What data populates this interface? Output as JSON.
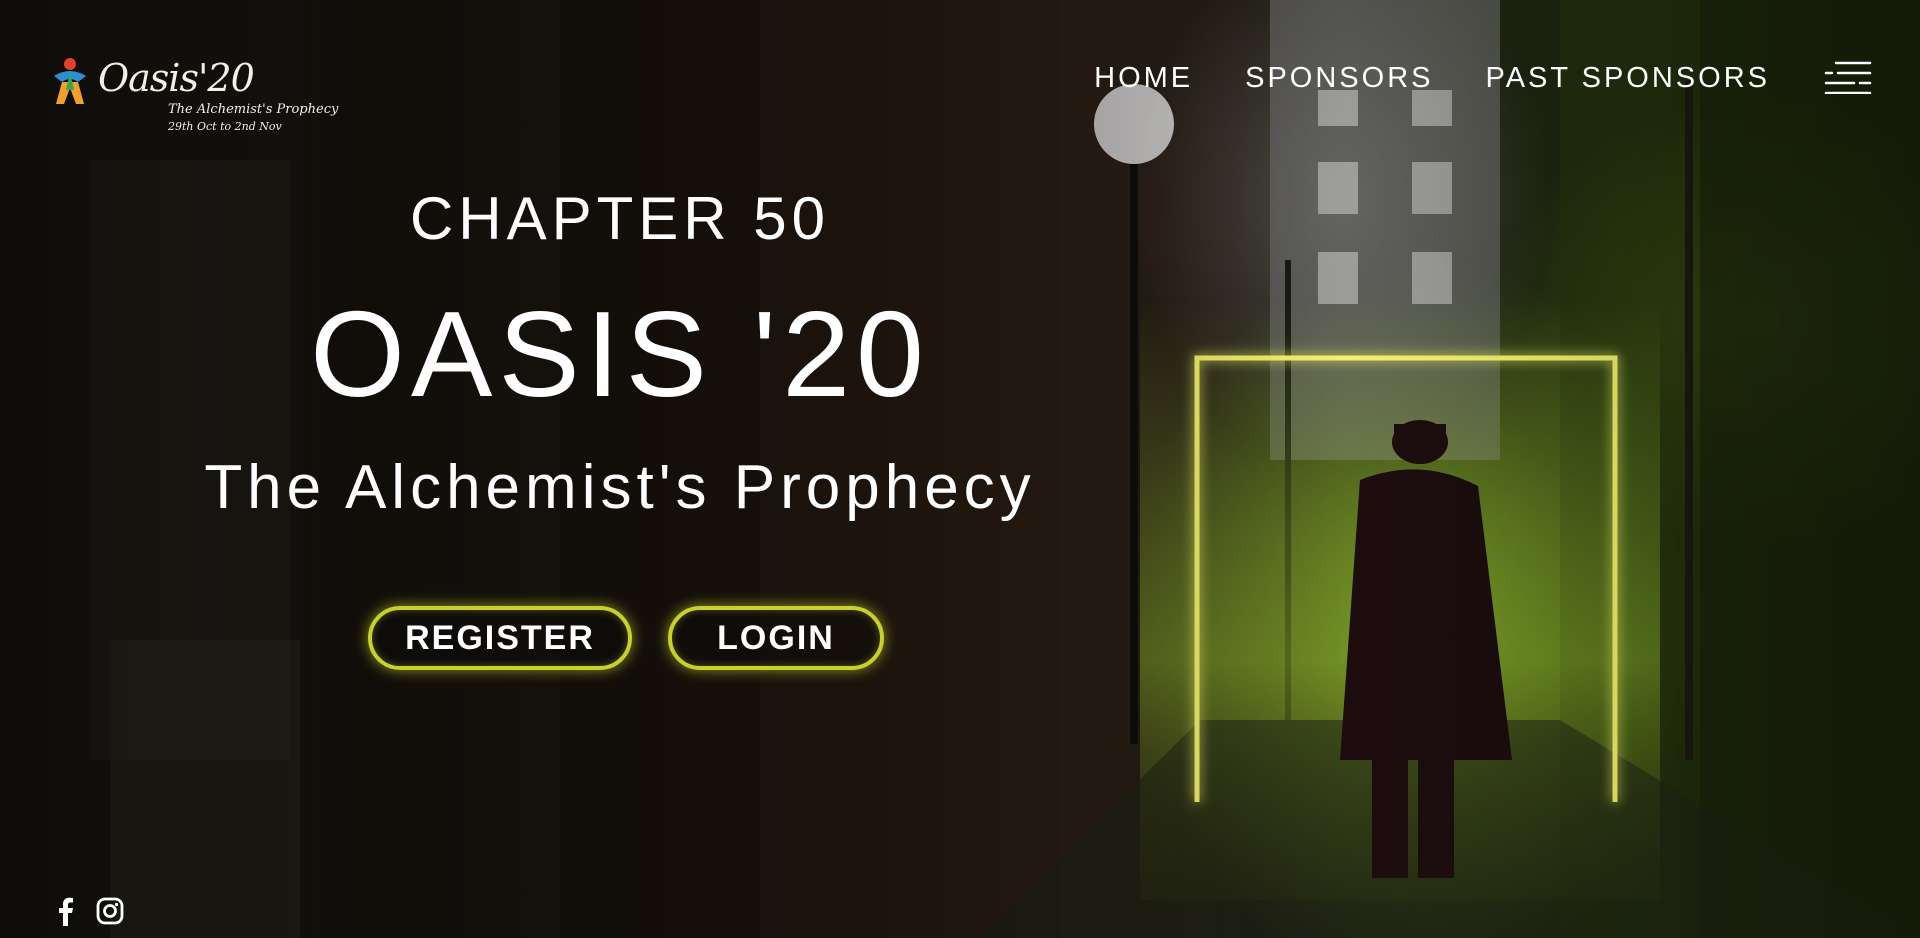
{
  "header": {
    "logo": {
      "wordmark": "Oasis'20",
      "tagline": "The Alchemist's Prophecy",
      "dates": "29th Oct to 2nd Nov"
    },
    "nav": [
      {
        "label": "HOME"
      },
      {
        "label": "SPONSORS"
      },
      {
        "label": "PAST SPONSORS"
      }
    ],
    "menu_icon": "hamburger-menu-icon"
  },
  "hero": {
    "chapter": "CHAPTER 50",
    "title": "OASIS '20",
    "subtitle": "The Alchemist's Prophecy",
    "buttons": {
      "register": "REGISTER",
      "login": "LOGIN"
    }
  },
  "social": [
    {
      "icon": "facebook-icon"
    },
    {
      "icon": "instagram-icon"
    }
  ],
  "colors": {
    "accent_neon": "#c7d12a",
    "text": "#ffffff",
    "background": "#0d0b09"
  }
}
